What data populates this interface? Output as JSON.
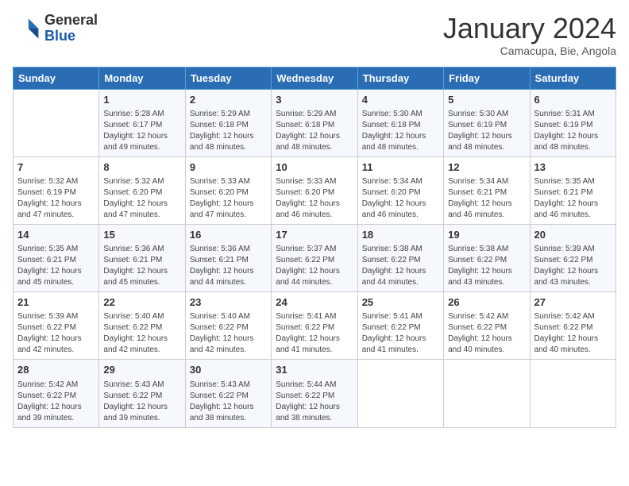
{
  "header": {
    "logo_line1": "General",
    "logo_line2": "Blue",
    "month_title": "January 2024",
    "subtitle": "Camacupa, Bie, Angola"
  },
  "days_of_week": [
    "Sunday",
    "Monday",
    "Tuesday",
    "Wednesday",
    "Thursday",
    "Friday",
    "Saturday"
  ],
  "weeks": [
    [
      {
        "day": "",
        "info": ""
      },
      {
        "day": "1",
        "info": "Sunrise: 5:28 AM\nSunset: 6:17 PM\nDaylight: 12 hours\nand 49 minutes."
      },
      {
        "day": "2",
        "info": "Sunrise: 5:29 AM\nSunset: 6:18 PM\nDaylight: 12 hours\nand 48 minutes."
      },
      {
        "day": "3",
        "info": "Sunrise: 5:29 AM\nSunset: 6:18 PM\nDaylight: 12 hours\nand 48 minutes."
      },
      {
        "day": "4",
        "info": "Sunrise: 5:30 AM\nSunset: 6:18 PM\nDaylight: 12 hours\nand 48 minutes."
      },
      {
        "day": "5",
        "info": "Sunrise: 5:30 AM\nSunset: 6:19 PM\nDaylight: 12 hours\nand 48 minutes."
      },
      {
        "day": "6",
        "info": "Sunrise: 5:31 AM\nSunset: 6:19 PM\nDaylight: 12 hours\nand 48 minutes."
      }
    ],
    [
      {
        "day": "7",
        "info": "Sunrise: 5:32 AM\nSunset: 6:19 PM\nDaylight: 12 hours\nand 47 minutes."
      },
      {
        "day": "8",
        "info": "Sunrise: 5:32 AM\nSunset: 6:20 PM\nDaylight: 12 hours\nand 47 minutes."
      },
      {
        "day": "9",
        "info": "Sunrise: 5:33 AM\nSunset: 6:20 PM\nDaylight: 12 hours\nand 47 minutes."
      },
      {
        "day": "10",
        "info": "Sunrise: 5:33 AM\nSunset: 6:20 PM\nDaylight: 12 hours\nand 46 minutes."
      },
      {
        "day": "11",
        "info": "Sunrise: 5:34 AM\nSunset: 6:20 PM\nDaylight: 12 hours\nand 46 minutes."
      },
      {
        "day": "12",
        "info": "Sunrise: 5:34 AM\nSunset: 6:21 PM\nDaylight: 12 hours\nand 46 minutes."
      },
      {
        "day": "13",
        "info": "Sunrise: 5:35 AM\nSunset: 6:21 PM\nDaylight: 12 hours\nand 46 minutes."
      }
    ],
    [
      {
        "day": "14",
        "info": "Sunrise: 5:35 AM\nSunset: 6:21 PM\nDaylight: 12 hours\nand 45 minutes."
      },
      {
        "day": "15",
        "info": "Sunrise: 5:36 AM\nSunset: 6:21 PM\nDaylight: 12 hours\nand 45 minutes."
      },
      {
        "day": "16",
        "info": "Sunrise: 5:36 AM\nSunset: 6:21 PM\nDaylight: 12 hours\nand 44 minutes."
      },
      {
        "day": "17",
        "info": "Sunrise: 5:37 AM\nSunset: 6:22 PM\nDaylight: 12 hours\nand 44 minutes."
      },
      {
        "day": "18",
        "info": "Sunrise: 5:38 AM\nSunset: 6:22 PM\nDaylight: 12 hours\nand 44 minutes."
      },
      {
        "day": "19",
        "info": "Sunrise: 5:38 AM\nSunset: 6:22 PM\nDaylight: 12 hours\nand 43 minutes."
      },
      {
        "day": "20",
        "info": "Sunrise: 5:39 AM\nSunset: 6:22 PM\nDaylight: 12 hours\nand 43 minutes."
      }
    ],
    [
      {
        "day": "21",
        "info": "Sunrise: 5:39 AM\nSunset: 6:22 PM\nDaylight: 12 hours\nand 42 minutes."
      },
      {
        "day": "22",
        "info": "Sunrise: 5:40 AM\nSunset: 6:22 PM\nDaylight: 12 hours\nand 42 minutes."
      },
      {
        "day": "23",
        "info": "Sunrise: 5:40 AM\nSunset: 6:22 PM\nDaylight: 12 hours\nand 42 minutes."
      },
      {
        "day": "24",
        "info": "Sunrise: 5:41 AM\nSunset: 6:22 PM\nDaylight: 12 hours\nand 41 minutes."
      },
      {
        "day": "25",
        "info": "Sunrise: 5:41 AM\nSunset: 6:22 PM\nDaylight: 12 hours\nand 41 minutes."
      },
      {
        "day": "26",
        "info": "Sunrise: 5:42 AM\nSunset: 6:22 PM\nDaylight: 12 hours\nand 40 minutes."
      },
      {
        "day": "27",
        "info": "Sunrise: 5:42 AM\nSunset: 6:22 PM\nDaylight: 12 hours\nand 40 minutes."
      }
    ],
    [
      {
        "day": "28",
        "info": "Sunrise: 5:42 AM\nSunset: 6:22 PM\nDaylight: 12 hours\nand 39 minutes."
      },
      {
        "day": "29",
        "info": "Sunrise: 5:43 AM\nSunset: 6:22 PM\nDaylight: 12 hours\nand 39 minutes."
      },
      {
        "day": "30",
        "info": "Sunrise: 5:43 AM\nSunset: 6:22 PM\nDaylight: 12 hours\nand 38 minutes."
      },
      {
        "day": "31",
        "info": "Sunrise: 5:44 AM\nSunset: 6:22 PM\nDaylight: 12 hours\nand 38 minutes."
      },
      {
        "day": "",
        "info": ""
      },
      {
        "day": "",
        "info": ""
      },
      {
        "day": "",
        "info": ""
      }
    ]
  ]
}
